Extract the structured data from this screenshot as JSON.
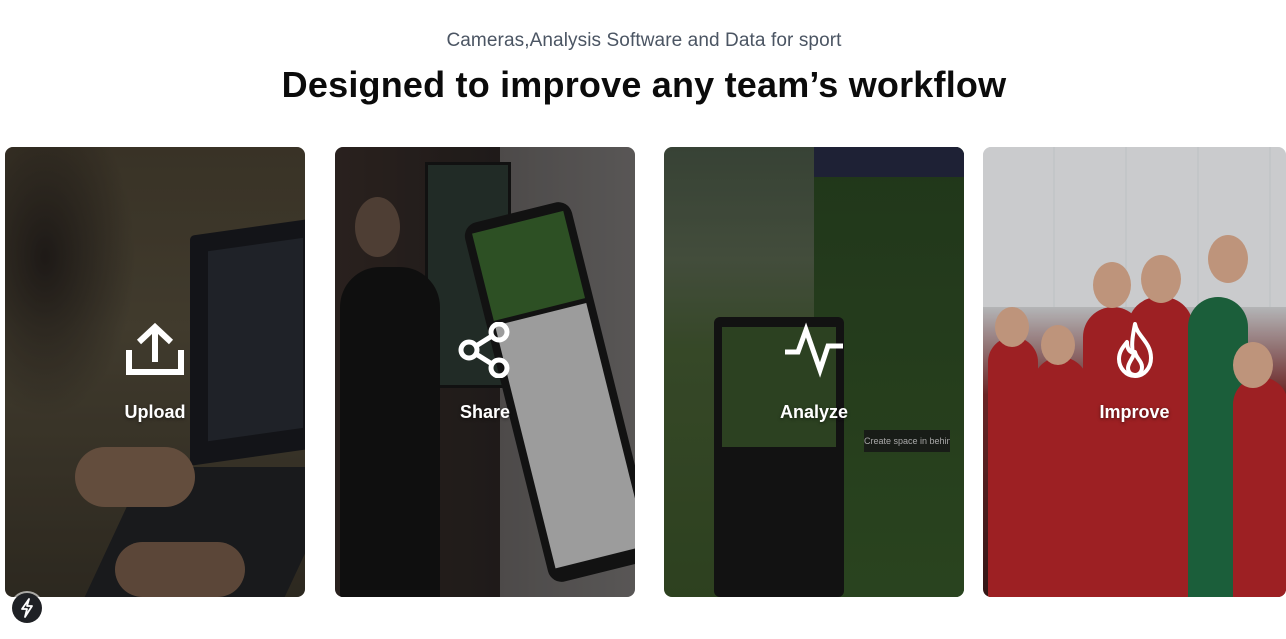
{
  "header": {
    "eyebrow": "Cameras,Analysis Software and Data for sport",
    "headline": "Designed to improve any team’s workflow"
  },
  "cards": [
    {
      "label": "Upload",
      "icon": "upload-icon"
    },
    {
      "label": "Share",
      "icon": "share-icon"
    },
    {
      "label": "Analyze",
      "icon": "analytics-pulse-icon"
    },
    {
      "label": "Improve",
      "icon": "flame-icon"
    }
  ],
  "analyze_card": {
    "overlay_caption": "Create space in behind defence"
  },
  "badge": {
    "icon": "lightning-bolt-icon"
  },
  "colors": {
    "eyebrow": "#4b5563",
    "headline": "#0b0b0b",
    "card_label": "#ffffff"
  }
}
